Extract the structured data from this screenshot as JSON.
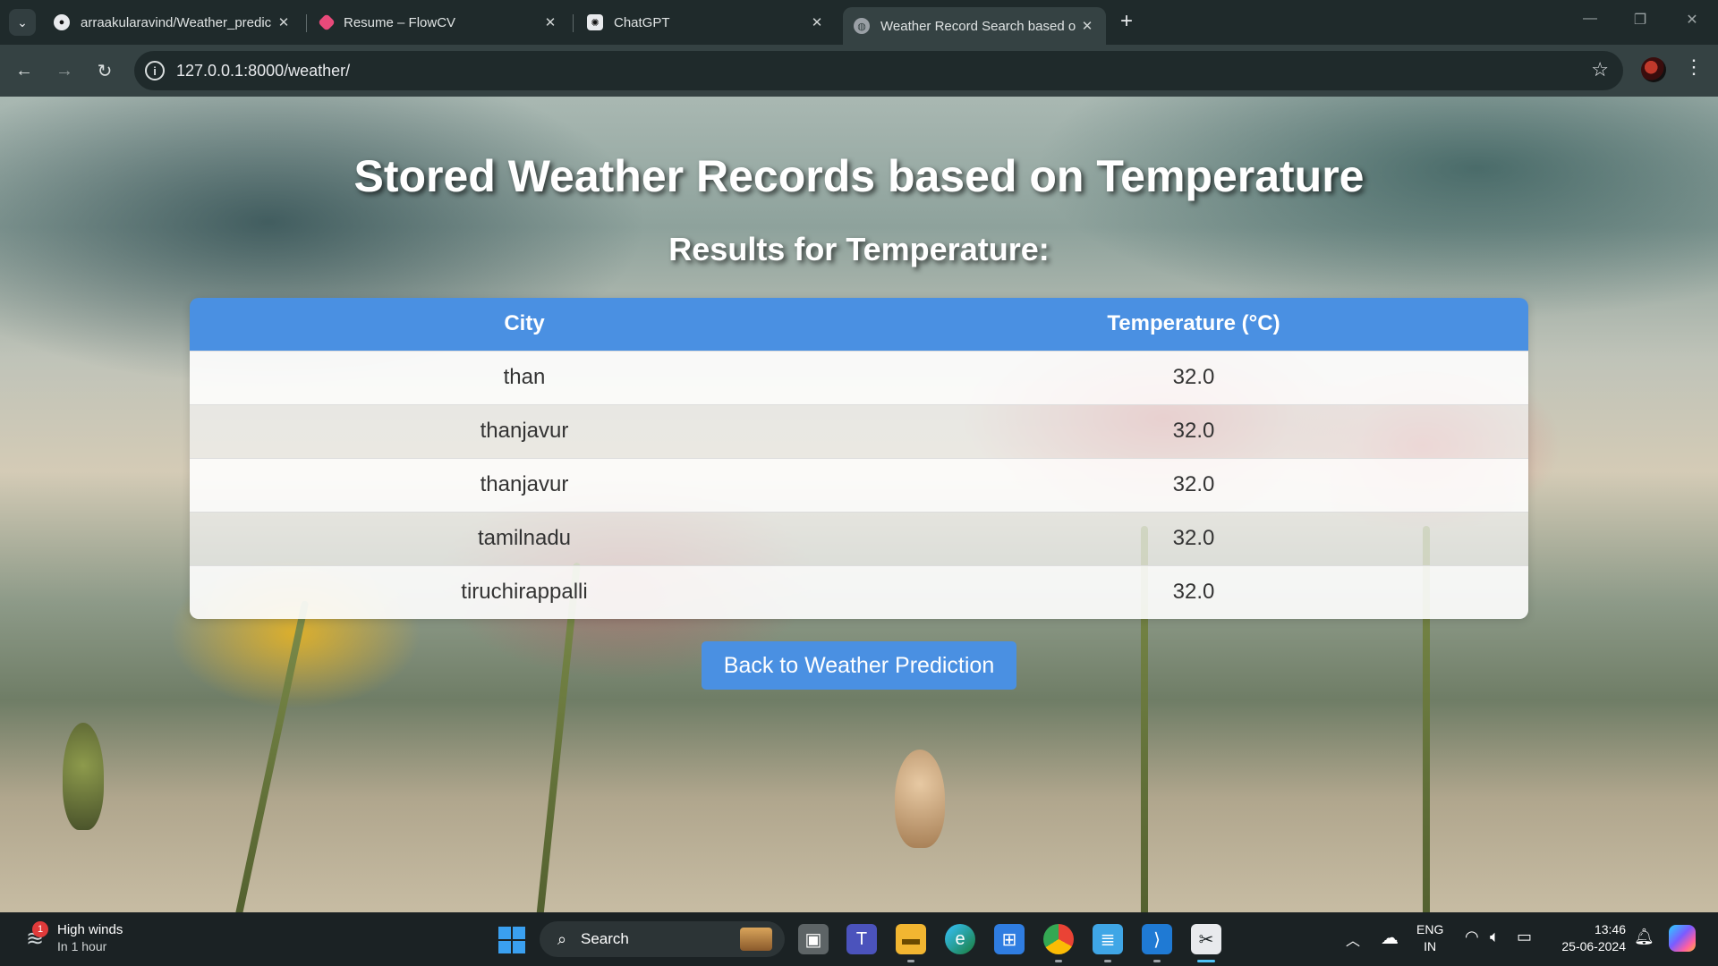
{
  "browser": {
    "tabs": [
      {
        "title": "arraakularavind/Weather_predic",
        "icon": "github-icon",
        "active": false
      },
      {
        "title": "Resume – FlowCV",
        "icon": "flowcv-icon",
        "active": false
      },
      {
        "title": "ChatGPT",
        "icon": "chatgpt-icon",
        "active": false
      },
      {
        "title": "Weather Record Search based o",
        "icon": "globe-icon",
        "active": true
      }
    ],
    "url": "127.0.0.1:8000/weather/"
  },
  "page": {
    "title": "Stored Weather Records based on Temperature",
    "subtitle": "Results for Temperature:",
    "table": {
      "headers": [
        "City",
        "Temperature (°C)"
      ],
      "rows": [
        {
          "city": "than",
          "temperature": "32.0"
        },
        {
          "city": "thanjavur",
          "temperature": "32.0"
        },
        {
          "city": "thanjavur",
          "temperature": "32.0"
        },
        {
          "city": "tamilnadu",
          "temperature": "32.0"
        },
        {
          "city": "tiruchirappalli",
          "temperature": "32.0"
        }
      ]
    },
    "back_button": "Back to Weather Prediction",
    "colors": {
      "accent": "#4a90e2",
      "text": "#333333"
    }
  },
  "taskbar": {
    "weather": {
      "title": "High winds",
      "subtitle": "In 1 hour",
      "badge": "1"
    },
    "search_label": "Search",
    "language": {
      "line1": "ENG",
      "line2": "IN"
    },
    "clock": {
      "time": "13:46",
      "date": "25-06-2024"
    }
  }
}
